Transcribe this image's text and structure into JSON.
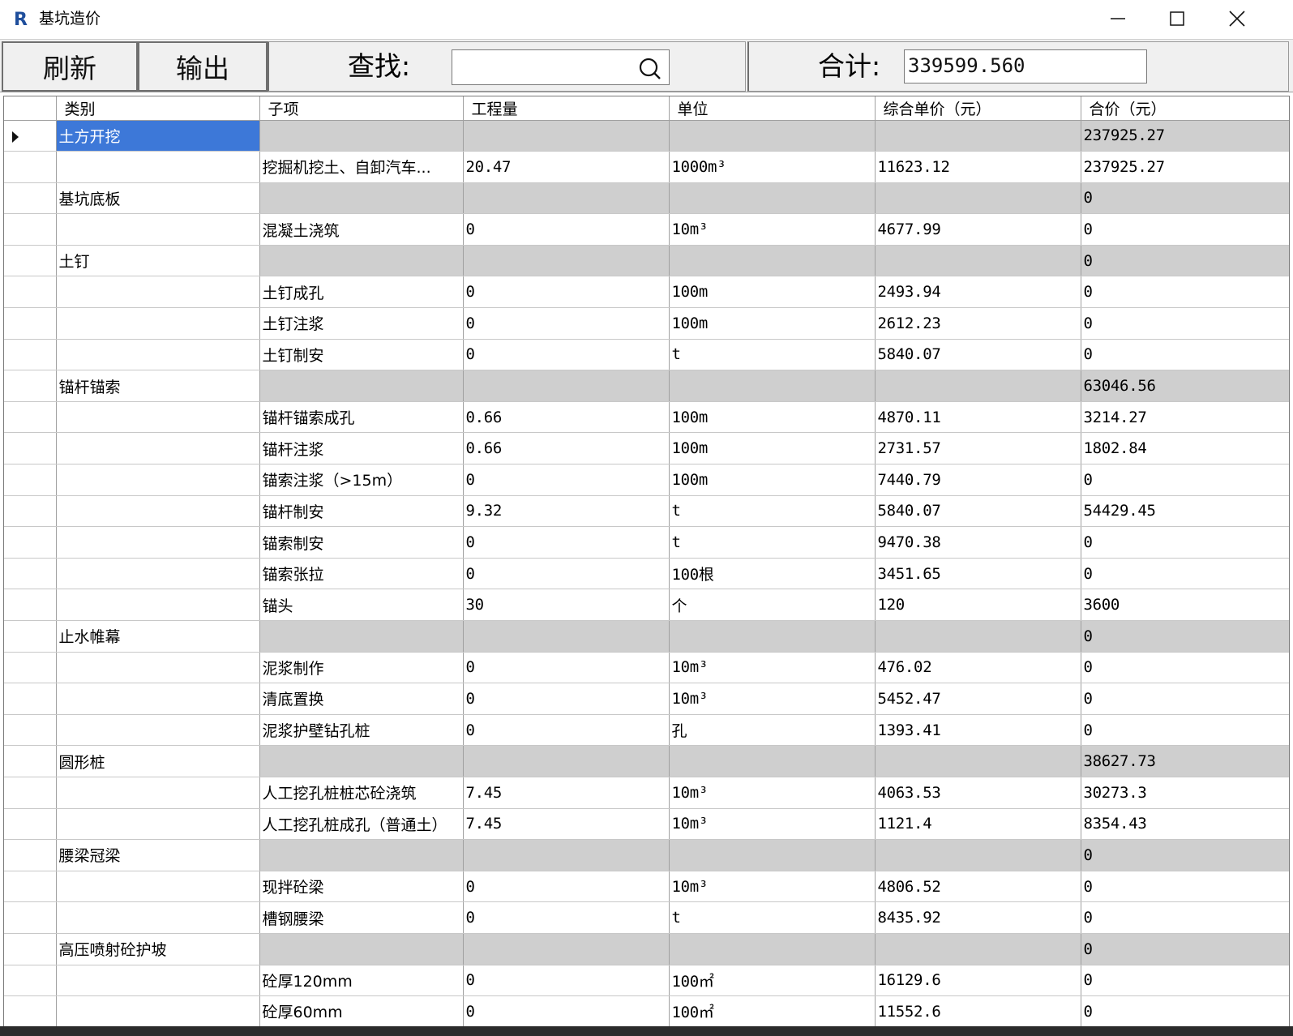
{
  "window": {
    "title": "基坑造价",
    "icon": "revit-r-icon"
  },
  "toolbar": {
    "refresh_label": "刷新",
    "export_label": "输出",
    "search_label": "查找:",
    "search_value": "",
    "total_label": "合计:",
    "total_value": "339599.560"
  },
  "table": {
    "headers": [
      "类别",
      "子项",
      "工程量",
      "单位",
      "综合单价（元）",
      "合价（元）"
    ],
    "rows": [
      {
        "group": true,
        "selected": true,
        "category": "土方开挖",
        "item": "",
        "qty": "",
        "unit": "",
        "price": "",
        "total": "237925.27"
      },
      {
        "group": false,
        "category": "",
        "item": "挖掘机挖土、自卸汽车...",
        "qty": "20.47",
        "unit": "1000m³",
        "price": "11623.12",
        "total": "237925.27"
      },
      {
        "group": true,
        "category": "基坑底板",
        "item": "",
        "qty": "",
        "unit": "",
        "price": "",
        "total": "0"
      },
      {
        "group": false,
        "category": "",
        "item": "混凝土浇筑",
        "qty": "0",
        "unit": "10m³",
        "price": "4677.99",
        "total": "0"
      },
      {
        "group": true,
        "category": "土钉",
        "item": "",
        "qty": "",
        "unit": "",
        "price": "",
        "total": "0"
      },
      {
        "group": false,
        "category": "",
        "item": "土钉成孔",
        "qty": "0",
        "unit": "100m",
        "price": "2493.94",
        "total": "0"
      },
      {
        "group": false,
        "category": "",
        "item": "土钉注浆",
        "qty": "0",
        "unit": "100m",
        "price": "2612.23",
        "total": "0"
      },
      {
        "group": false,
        "category": "",
        "item": "土钉制安",
        "qty": "0",
        "unit": "t",
        "price": "5840.07",
        "total": "0"
      },
      {
        "group": true,
        "category": "锚杆锚索",
        "item": "",
        "qty": "",
        "unit": "",
        "price": "",
        "total": "63046.56"
      },
      {
        "group": false,
        "category": "",
        "item": "锚杆锚索成孔",
        "qty": "0.66",
        "unit": "100m",
        "price": "4870.11",
        "total": "3214.27"
      },
      {
        "group": false,
        "category": "",
        "item": "锚杆注浆",
        "qty": "0.66",
        "unit": "100m",
        "price": "2731.57",
        "total": "1802.84"
      },
      {
        "group": false,
        "category": "",
        "item": "锚索注浆（>15m）",
        "qty": "0",
        "unit": "100m",
        "price": "7440.79",
        "total": "0"
      },
      {
        "group": false,
        "category": "",
        "item": "锚杆制安",
        "qty": "9.32",
        "unit": "t",
        "price": "5840.07",
        "total": "54429.45"
      },
      {
        "group": false,
        "category": "",
        "item": "锚索制安",
        "qty": "0",
        "unit": "t",
        "price": "9470.38",
        "total": "0"
      },
      {
        "group": false,
        "category": "",
        "item": "锚索张拉",
        "qty": "0",
        "unit": "100根",
        "price": "3451.65",
        "total": "0"
      },
      {
        "group": false,
        "category": "",
        "item": "锚头",
        "qty": "30",
        "unit": "个",
        "price": "120",
        "total": "3600"
      },
      {
        "group": true,
        "category": "止水帷幕",
        "item": "",
        "qty": "",
        "unit": "",
        "price": "",
        "total": "0"
      },
      {
        "group": false,
        "category": "",
        "item": "泥浆制作",
        "qty": "0",
        "unit": "10m³",
        "price": "476.02",
        "total": "0"
      },
      {
        "group": false,
        "category": "",
        "item": "清底置换",
        "qty": "0",
        "unit": "10m³",
        "price": "5452.47",
        "total": "0"
      },
      {
        "group": false,
        "category": "",
        "item": "泥浆护壁钻孔桩",
        "qty": "0",
        "unit": "孔",
        "price": "1393.41",
        "total": "0"
      },
      {
        "group": true,
        "category": "圆形桩",
        "item": "",
        "qty": "",
        "unit": "",
        "price": "",
        "total": "38627.73"
      },
      {
        "group": false,
        "category": "",
        "item": "人工挖孔桩桩芯砼浇筑",
        "qty": "7.45",
        "unit": "10m³",
        "price": "4063.53",
        "total": "30273.3"
      },
      {
        "group": false,
        "category": "",
        "item": "人工挖孔桩成孔（普通土）",
        "qty": "7.45",
        "unit": "10m³",
        "price": "1121.4",
        "total": "8354.43"
      },
      {
        "group": true,
        "category": "腰梁冠梁",
        "item": "",
        "qty": "",
        "unit": "",
        "price": "",
        "total": "0"
      },
      {
        "group": false,
        "category": "",
        "item": "现拌砼梁",
        "qty": "0",
        "unit": "10m³",
        "price": "4806.52",
        "total": "0"
      },
      {
        "group": false,
        "category": "",
        "item": "槽钢腰梁",
        "qty": "0",
        "unit": "t",
        "price": "8435.92",
        "total": "0"
      },
      {
        "group": true,
        "category": "高压喷射砼护坡",
        "item": "",
        "qty": "",
        "unit": "",
        "price": "",
        "total": "0"
      },
      {
        "group": false,
        "category": "",
        "item": "砼厚120mm",
        "qty": "0",
        "unit": "100㎡",
        "price": "16129.6",
        "total": "0"
      },
      {
        "group": false,
        "category": "",
        "item": "砼厚60mm",
        "qty": "0",
        "unit": "100㎡",
        "price": "11552.6",
        "total": "0"
      }
    ]
  },
  "colors": {
    "selection": "#3d78d8",
    "group_row": "#cfcfcf",
    "toolbar_bg": "#f0f0f0",
    "icon_blue": "#1f4e9c"
  }
}
